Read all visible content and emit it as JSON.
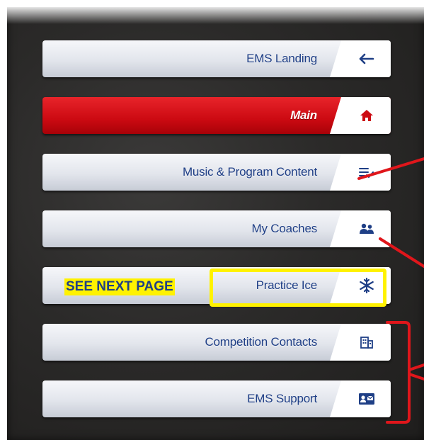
{
  "nav": {
    "items": [
      {
        "label": "EMS Landing",
        "icon": "arrow-left-icon",
        "active": false
      },
      {
        "label": "Main",
        "icon": "home-icon",
        "active": true
      },
      {
        "label": "Music & Program Content",
        "icon": "checklist-icon",
        "active": false
      },
      {
        "label": "My Coaches",
        "icon": "people-icon",
        "active": false
      },
      {
        "label": "Practice Ice",
        "icon": "snowflake-icon",
        "active": false
      },
      {
        "label": "Competition Contacts",
        "icon": "building-icon",
        "active": false
      },
      {
        "label": "EMS Support",
        "icon": "contact-card-icon",
        "active": false
      }
    ]
  },
  "annotation": {
    "see_next_page": "SEE NEXT PAGE",
    "highlight_color": "#fff200",
    "marker_color": "#e0161b"
  },
  "colors": {
    "accent_blue": "#1f3f86",
    "active_red": "#d40c14"
  }
}
